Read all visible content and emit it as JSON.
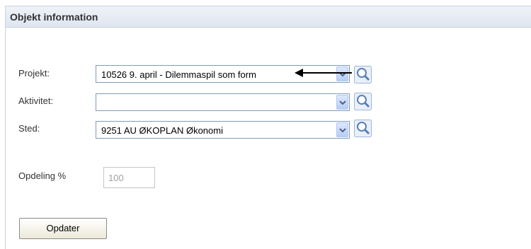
{
  "panel": {
    "title": "Objekt information"
  },
  "form": {
    "projekt": {
      "label": "Projekt:",
      "value": "10526 9. april - Dilemmaspil som form"
    },
    "aktivitet": {
      "label": "Aktivitet:",
      "value": ""
    },
    "sted": {
      "label": "Sted:",
      "value": "9251 AU ØKOPLAN Økonomi"
    },
    "opdeling": {
      "label": "Opdeling %",
      "value": "100"
    }
  },
  "buttons": {
    "update_label": "Opdater"
  },
  "icons": {
    "dropdown": "chevron-down-icon",
    "lookup": "magnifier-icon",
    "annotation": "arrow-left-icon"
  },
  "colors": {
    "header_bg": "#dfe6f0",
    "select_border": "#7f9db9",
    "dropdown_button": "#b7cdf5"
  }
}
